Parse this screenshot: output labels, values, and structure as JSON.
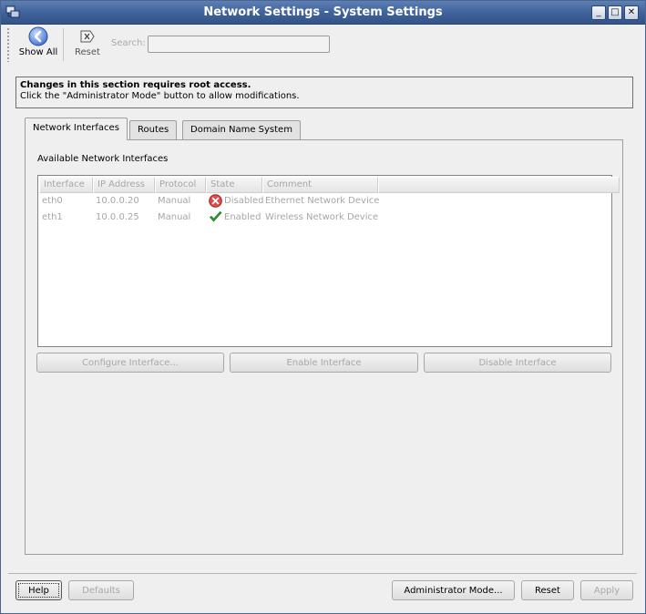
{
  "window": {
    "title": "Network Settings - System Settings",
    "controls": {
      "minimize": "_",
      "maximize": "□",
      "close": "✕"
    }
  },
  "toolbar": {
    "show_all_label": "Show All",
    "reset_label": "Reset",
    "search_label": "Search:",
    "search_value": ""
  },
  "notice": {
    "heading": "Changes in this section requires root access.",
    "text": "Click the \"Administrator Mode\" button to allow modifications."
  },
  "tabs": [
    {
      "label": "Network Interfaces",
      "active": true
    },
    {
      "label": "Routes",
      "active": false
    },
    {
      "label": "Domain Name System",
      "active": false
    }
  ],
  "interfaces": {
    "section_label": "Available Network Interfaces",
    "columns": [
      "Interface",
      "IP Address",
      "Protocol",
      "State",
      "Comment"
    ],
    "rows": [
      {
        "interface": "eth0",
        "ip": "10.0.0.20",
        "protocol": "Manual",
        "state": "Disabled",
        "state_icon": "red-x-icon",
        "comment": "Ethernet Network Device"
      },
      {
        "interface": "eth1",
        "ip": "10.0.0.25",
        "protocol": "Manual",
        "state": "Enabled",
        "state_icon": "green-check-icon",
        "comment": "Wireless Network Device"
      }
    ]
  },
  "actions": {
    "configure": "Configure Interface...",
    "enable": "Enable Interface",
    "disable": "Disable Interface"
  },
  "footer": {
    "help": "Help",
    "defaults": "Defaults",
    "admin_mode": "Administrator Mode...",
    "reset": "Reset",
    "apply": "Apply"
  },
  "colors": {
    "titlebar": "#3f619a",
    "window_bg": "#efefef",
    "disabled_text": "#a6a6a6"
  }
}
